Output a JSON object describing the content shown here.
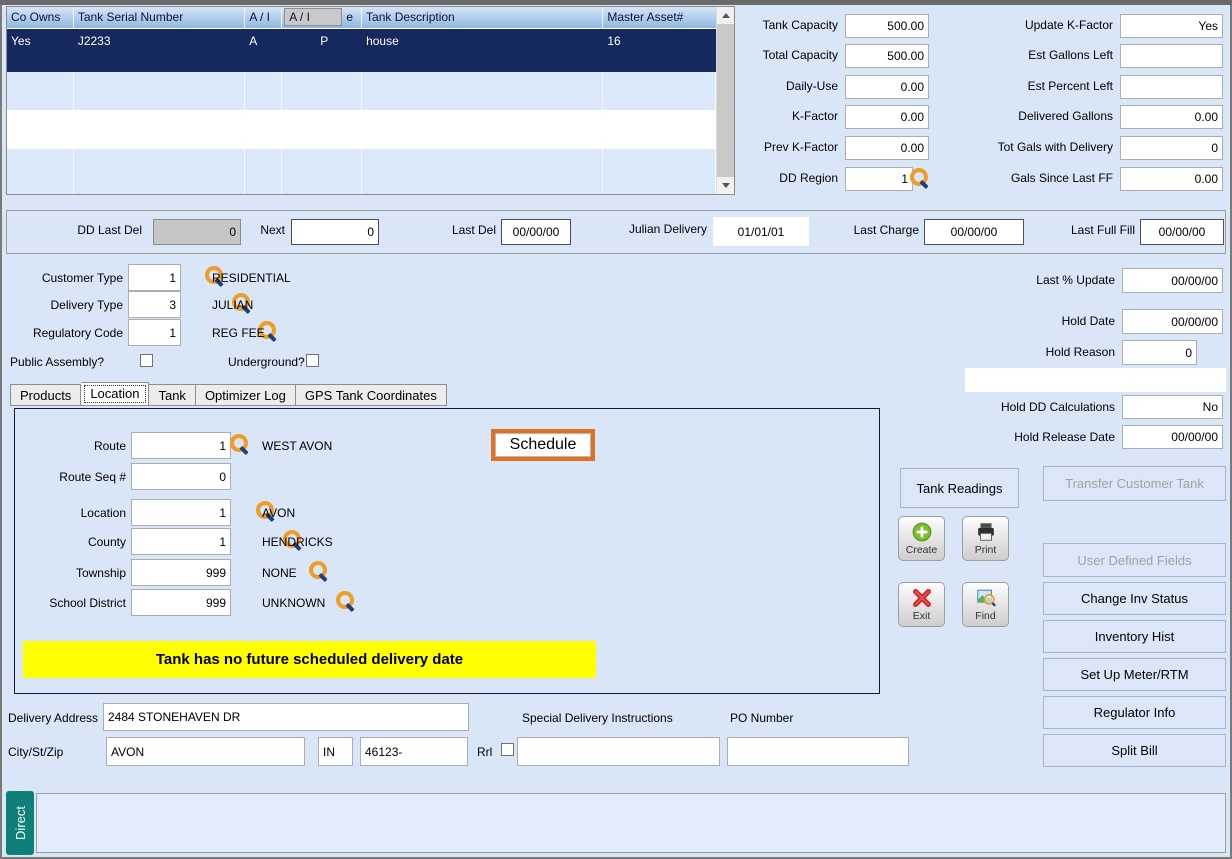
{
  "table": {
    "headers": {
      "co_owns": "Co Owns",
      "serial": "Tank Serial Number",
      "ai_1": "A / I",
      "ai_edit": "A / I",
      "partial": "e",
      "description": "Tank Description",
      "master_asset": "Master Asset#"
    },
    "row": {
      "co_owns": "Yes",
      "serial": "J2233",
      "ai_1": "A",
      "ai_2": "P",
      "description": "house",
      "master_asset": "16"
    }
  },
  "capacity": {
    "tank_capacity": {
      "label": "Tank Capacity",
      "value": "500.00"
    },
    "total_capacity": {
      "label": "Total Capacity",
      "value": "500.00"
    },
    "daily_use": {
      "label": "Daily-Use",
      "value": "0.00"
    },
    "k_factor": {
      "label": "K-Factor",
      "value": "0.00"
    },
    "prev_k_factor": {
      "label": "Prev K-Factor",
      "value": "0.00"
    },
    "dd_region": {
      "label": "DD Region",
      "value": "1"
    },
    "update_k_factor": {
      "label": "Update K-Factor",
      "value": "Yes"
    },
    "est_gallons_left": {
      "label": "Est Gallons Left",
      "value": ""
    },
    "est_percent_left": {
      "label": "Est Percent Left",
      "value": ""
    },
    "delivered_gallons": {
      "label": "Delivered Gallons",
      "value": "0.00"
    },
    "tot_gals_with_delivery": {
      "label": "Tot Gals with Delivery",
      "value": "0"
    },
    "gals_since_last_ff": {
      "label": "Gals Since Last FF",
      "value": "0.00"
    }
  },
  "dd_bar": {
    "dd_last_del": {
      "label": "DD Last Del",
      "value": "0"
    },
    "next": {
      "label": "Next",
      "value": "0"
    },
    "last_del": {
      "label": "Last  Del",
      "value": "00/00/00"
    },
    "julian_delivery": {
      "label": "Julian Delivery",
      "value": "01/01/01"
    },
    "last_charge": {
      "label": "Last Charge",
      "value": "00/00/00"
    },
    "last_full_fill": {
      "label": "Last Full Fill",
      "value": "00/00/00"
    }
  },
  "codes": {
    "customer_type": {
      "label": "Customer Type",
      "value": "1",
      "desc": "RESIDENTIAL"
    },
    "delivery_type": {
      "label": "Delivery Type",
      "value": "3",
      "desc": "JULIAN"
    },
    "regulatory_code": {
      "label": "Regulatory Code",
      "value": "1",
      "desc": "REG FEE"
    },
    "public_assembly_label": "Public Assembly?",
    "underground_label": "Underground?"
  },
  "hold": {
    "last_pct_update": {
      "label": "Last % Update",
      "value": "00/00/00"
    },
    "hold_date": {
      "label": "Hold Date",
      "value": "00/00/00"
    },
    "hold_reason": {
      "label": "Hold Reason",
      "value": "0"
    },
    "hold_dd_calculations": {
      "label": "Hold DD Calculations",
      "value": "No"
    },
    "hold_release_date": {
      "label": "Hold Release Date",
      "value": "00/00/00"
    }
  },
  "tabs": {
    "items": [
      "Products",
      "Location",
      "Tank",
      "Optimizer Log",
      "GPS Tank Coordinates"
    ],
    "selected": "Location"
  },
  "location_tab": {
    "route": {
      "label": "Route",
      "value": "1",
      "desc": "WEST AVON"
    },
    "route_seq": {
      "label": "Route Seq #",
      "value": "0"
    },
    "location": {
      "label": "Location",
      "value": "1",
      "desc": "AVON"
    },
    "county": {
      "label": "County",
      "value": "1",
      "desc": "HENDRICKS"
    },
    "township": {
      "label": "Township",
      "value": "999",
      "desc": "NONE"
    },
    "school_district": {
      "label": "School District",
      "value": "999",
      "desc": "UNKNOWN"
    },
    "schedule_button": "Schedule",
    "banner": "Tank has no future scheduled delivery date"
  },
  "actions": {
    "tank_readings": "Tank Readings",
    "transfer_customer_tank": "Transfer Customer Tank",
    "create": "Create",
    "print": "Print",
    "exit": "Exit",
    "find": "Find",
    "user_defined_fields": "User Defined Fields",
    "change_inv_status": "Change Inv Status",
    "inventory_hist": "Inventory Hist",
    "set_up_meter_rtm": "Set Up Meter/RTM",
    "regulator_info": "Regulator Info",
    "split_bill": "Split Bill"
  },
  "address": {
    "delivery_address": {
      "label": "Delivery Address",
      "value": "2484 STONEHAVEN DR"
    },
    "special_delivery_instructions": {
      "label": "Special Delivery Instructions",
      "value": ""
    },
    "po_number": {
      "label": "PO Number",
      "value": ""
    },
    "city_st_zip": {
      "label": "City/St/Zip",
      "city": "AVON",
      "state": "IN",
      "zip": "46123-"
    },
    "rrl_label": "Rrl"
  },
  "bottom": {
    "direct_tab": "Direct"
  }
}
